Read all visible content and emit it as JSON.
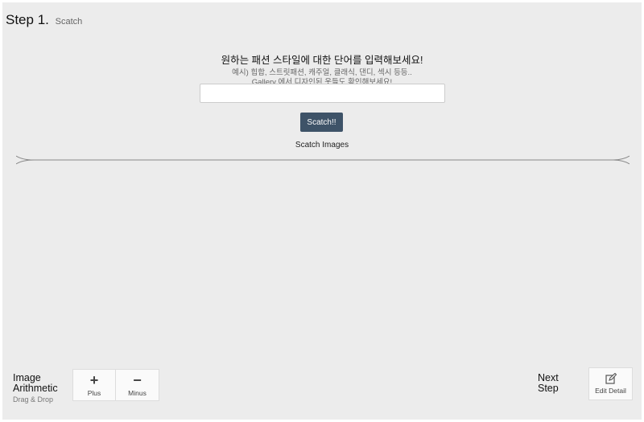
{
  "header": {
    "step_label": "Step 1.",
    "step_sub": "Scatch"
  },
  "prompt": {
    "main": "원하는 패션 스타일에 대한 단어를 입력해보세요!",
    "example": "예시) 힙합, 스트릿패션, 캐주얼, 클래식, 댄디, 섹시 등등..",
    "gallery_hint": "Gallery 에서 디자인된 옷들도 확인해보세요!"
  },
  "search": {
    "value": "",
    "placeholder": ""
  },
  "scatch_button": "Scatch!!",
  "images_label": "Scatch Images",
  "image_arithmetic": {
    "title_line1": "Image",
    "title_line2": "Arithmetic",
    "subtitle": "Drag & Drop",
    "plus_label": "Plus",
    "minus_label": "Minus"
  },
  "next_step": {
    "line1": "Next",
    "line2": "Step",
    "edit_label": "Edit Detail",
    "edit_icon": "edit-icon"
  },
  "colors": {
    "background": "#ececec",
    "button": "#3e5368"
  }
}
